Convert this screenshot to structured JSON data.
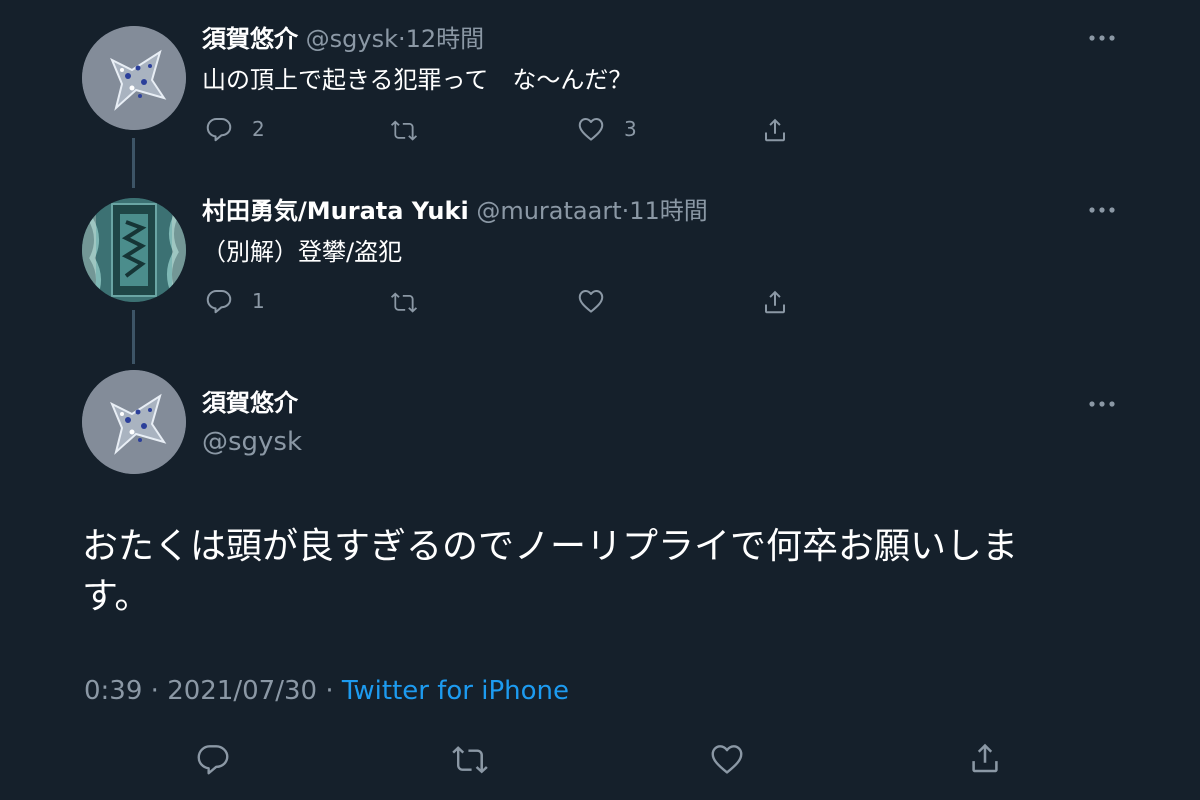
{
  "tweets": [
    {
      "display_name": "須賀悠介",
      "handle": "@sgysk",
      "separator": "·",
      "time": "12時間",
      "text": "山の頂上で起きる犯罪って　な〜んだ？",
      "reply_count": "2",
      "retweet_count": "",
      "like_count": "3"
    },
    {
      "display_name": "村田勇気/Murata Yuki",
      "handle": "@murataart",
      "separator": "·",
      "time": "11時間",
      "text": "（別解）登攀/盗犯",
      "reply_count": "1",
      "retweet_count": "",
      "like_count": ""
    }
  ],
  "main_tweet": {
    "display_name": "須賀悠介",
    "handle": "@sgysk",
    "text_line1": "おたくは頭が良すぎるのでノーリプライで何卒お願いしま",
    "text_line2": "す。",
    "time": "0:39",
    "separator1": "·",
    "date": "2021/07/30",
    "separator2": "·",
    "source": "Twitter for iPhone"
  },
  "icons": [
    "more-icon",
    "reply-icon",
    "retweet-icon",
    "like-icon",
    "share-icon"
  ],
  "colors": {
    "background": "#15202b",
    "secondary_text": "#8b98a5",
    "accent": "#1d9bf0",
    "thread_line": "#3d5466"
  }
}
